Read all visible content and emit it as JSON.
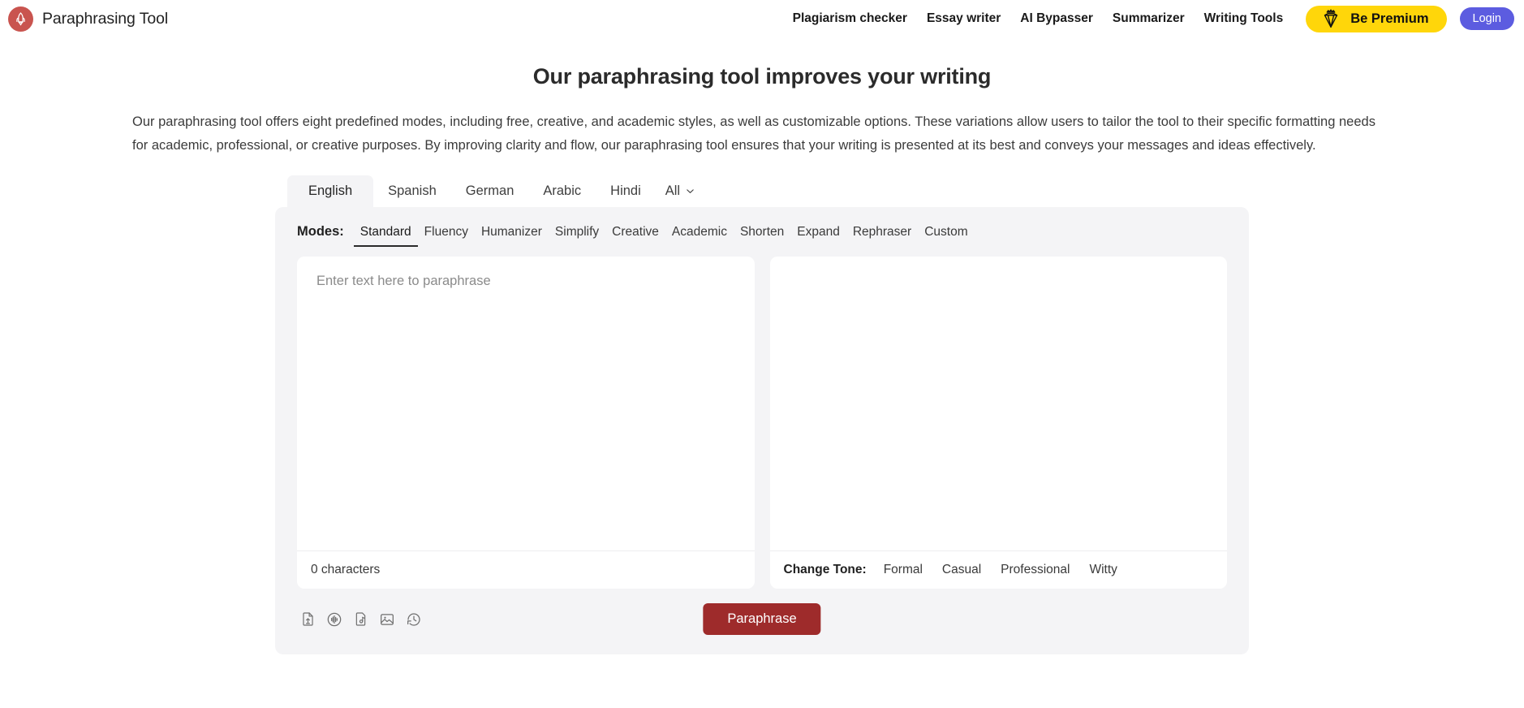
{
  "header": {
    "brand": "Paraphrasing Tool",
    "logo_icon": "rocket-pen-logo-icon",
    "logo_color": "#c9544f",
    "nav": [
      {
        "label": "Plagiarism checker"
      },
      {
        "label": "Essay writer"
      },
      {
        "label": "AI Bypasser"
      },
      {
        "label": "Summarizer"
      },
      {
        "label": "Writing Tools"
      }
    ],
    "premium": {
      "label": "Be Premium",
      "icon": "diamond-crown-icon",
      "bg": "#ffd60a"
    },
    "login": {
      "label": "Login",
      "bg": "#5c5ce0"
    }
  },
  "main": {
    "title": "Our paraphrasing tool improves your writing",
    "intro": "Our paraphrasing tool offers eight predefined modes, including free, creative, and academic styles, as well as customizable options. These variations allow users to tailor the tool to their specific formatting needs for academic, professional, or creative purposes. By improving clarity and flow, our paraphrasing tool ensures that your writing is presented at its best and conveys your messages and ideas effectively."
  },
  "languages": {
    "tabs": [
      {
        "label": "English",
        "active": true
      },
      {
        "label": "Spanish",
        "active": false
      },
      {
        "label": "German",
        "active": false
      },
      {
        "label": "Arabic",
        "active": false
      },
      {
        "label": "Hindi",
        "active": false
      }
    ],
    "all": {
      "label": "All",
      "icon": "chevron-down-icon"
    }
  },
  "modes": {
    "label": "Modes:",
    "items": [
      {
        "label": "Standard",
        "active": true
      },
      {
        "label": "Fluency",
        "active": false
      },
      {
        "label": "Humanizer",
        "active": false
      },
      {
        "label": "Simplify",
        "active": false
      },
      {
        "label": "Creative",
        "active": false
      },
      {
        "label": "Academic",
        "active": false
      },
      {
        "label": "Shorten",
        "active": false
      },
      {
        "label": "Expand",
        "active": false
      },
      {
        "label": "Rephraser",
        "active": false
      },
      {
        "label": "Custom",
        "active": false
      }
    ]
  },
  "input_panel": {
    "placeholder": "Enter text here to paraphrase",
    "value": "",
    "char_count": "0 characters"
  },
  "output_panel": {
    "value": "",
    "tone_label": "Change Tone:",
    "tones": [
      {
        "label": "Formal"
      },
      {
        "label": "Casual"
      },
      {
        "label": "Professional"
      },
      {
        "label": "Witty"
      }
    ]
  },
  "toolbar": {
    "icons": [
      {
        "name": "upload-file-icon"
      },
      {
        "name": "audio-waveform-icon"
      },
      {
        "name": "music-file-icon"
      },
      {
        "name": "image-icon"
      },
      {
        "name": "history-clock-icon"
      }
    ],
    "paraphrase_label": "Paraphrase",
    "paraphrase_color": "#9e2b2b"
  }
}
